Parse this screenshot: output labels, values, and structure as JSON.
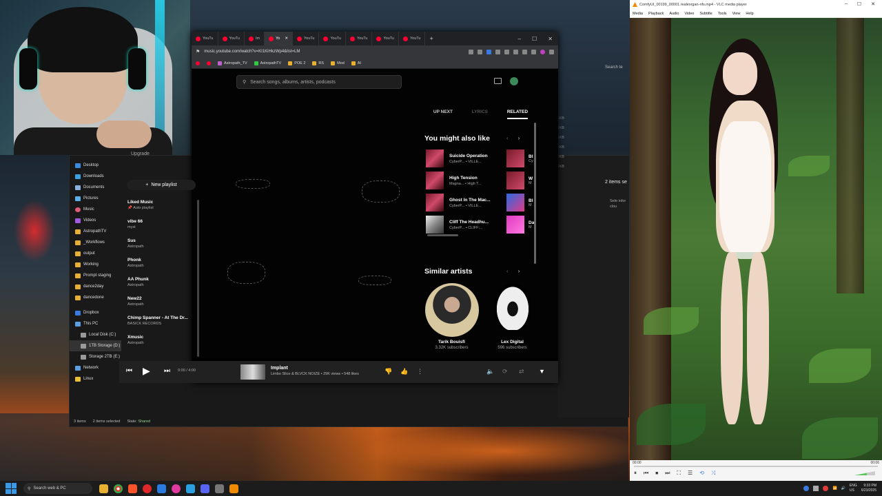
{
  "browser": {
    "tabs": [
      {
        "label": "YouTu"
      },
      {
        "label": "YouTu"
      },
      {
        "label": "Im"
      },
      {
        "label": "Yo",
        "active": true
      },
      {
        "label": "YouTu"
      },
      {
        "label": "YouTu"
      },
      {
        "label": "YouTu"
      },
      {
        "label": "YouTu"
      },
      {
        "label": "YouTu"
      }
    ],
    "new_tab": "+",
    "url": "music.youtube.com/watch?v=KI1KiHkzWp4&list=LM",
    "bookmarks": [
      "Astropath_TV",
      "AstropathTV",
      "POE 2",
      "RS",
      "Mod",
      "AI"
    ]
  },
  "ytmusic": {
    "search_placeholder": "Search songs, albums, artists, podcasts",
    "upgrade": "Upgrade",
    "new_playlist": "New playlist",
    "playlists": [
      {
        "title": "Liked Music",
        "sub": "Auto playlist"
      },
      {
        "title": "vibe 66",
        "sub": "myst"
      },
      {
        "title": "Sus",
        "sub": "Astropath"
      },
      {
        "title": "Phonk",
        "sub": "Astropath"
      },
      {
        "title": "AA Phunk",
        "sub": "Astropath"
      },
      {
        "title": "New22",
        "sub": "Astropath"
      },
      {
        "title": "Chimp Spanner - At The Dr...",
        "sub": "BASICK RECORDS"
      },
      {
        "title": "Xmusic",
        "sub": "Astropath"
      }
    ],
    "right_tabs": {
      "up_next": "UP NEXT",
      "lyrics": "LYRICS",
      "related": "RELATED"
    },
    "you_might_like_title": "You might also like",
    "songs": [
      {
        "title": "Suicide Operation",
        "artist": "CyberP... • VILLE..."
      },
      {
        "title": "High Tension",
        "artist": "Magna... • High T..."
      },
      {
        "title": "Ghost In The Mac...",
        "artist": "CyberP... • VILLE..."
      },
      {
        "title": "Cliff The Headhu...",
        "artist": "CyberP... • CLIFF:..."
      }
    ],
    "songs_col2": [
      {
        "title": "Bl",
        "artist": "Cy"
      },
      {
        "title": "W",
        "artist": "M"
      },
      {
        "title": "Bl",
        "artist": "M"
      },
      {
        "title": "Da",
        "artist": "M"
      }
    ],
    "similar_artists_title": "Similar artists",
    "artists": [
      {
        "name": "Tarik Bouisfi",
        "subs": "3.32K subscribers"
      },
      {
        "name": "Lex Digital",
        "subs": "596 subscribers"
      }
    ],
    "player": {
      "time": "0:00 / 4:00",
      "title": "Implant",
      "subtitle": "Limbo Slice & BLVCK NOIZE • 29K views • 548 likes"
    }
  },
  "explorer": {
    "nav": [
      "Desktop",
      "Downloads",
      "Documents",
      "Pictures",
      "Music",
      "Videos",
      "AstropathTV",
      "_Workflows",
      "output",
      "Working",
      "Prompt staging",
      "dance2day",
      "dancedone",
      "Dropbox",
      "This PC",
      "Local Disk (C:)",
      "1TB Storage (D:)",
      "Storage 2TB (E:)",
      "Network",
      "Linux"
    ],
    "status": {
      "items": "3 items",
      "selected": "2 items selected",
      "state": "State:",
      "shared": "Shared"
    },
    "search": "Search te",
    "items_selected": "2 items se",
    "select_text": "Sele infor clou",
    "sizes": [
      "4 KB",
      "4 KB",
      "4 KB",
      "4 KB",
      "4 KB",
      "4 KB"
    ]
  },
  "vlc": {
    "title": "ComfyUI_00199_00001.realesrgan-nfs.mp4 - VLC media player",
    "menu": [
      "Media",
      "Playback",
      "Audio",
      "Video",
      "Subtitle",
      "Tools",
      "View",
      "Help"
    ],
    "time_left": "00:00",
    "time_right": "00:06"
  },
  "taskbar": {
    "search": "Search web & PC",
    "lang": "ENG",
    "region": "US",
    "time": "9:33 PM",
    "date": "6/23/2025"
  },
  "colors": {
    "yt_red": "#ff0033",
    "vlc_orange": "#f08a00",
    "explorer_bg": "#191919"
  }
}
